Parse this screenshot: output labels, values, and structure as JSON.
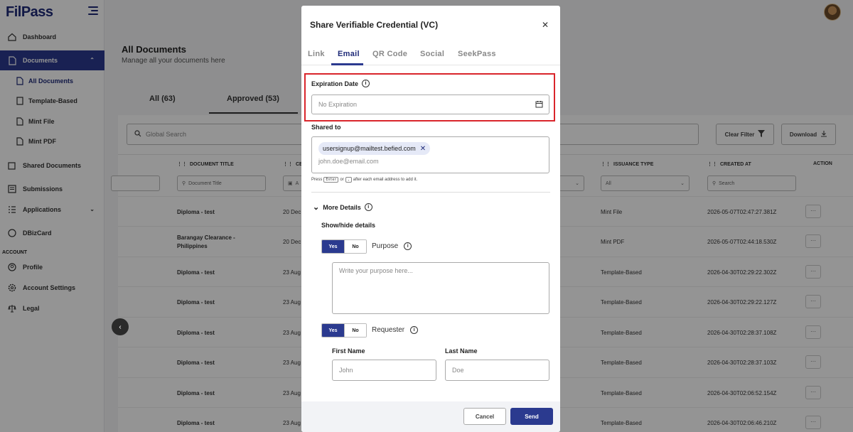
{
  "app": {
    "logo": "FilPass"
  },
  "sidebar": {
    "items": [
      {
        "label": "Dashboard",
        "icon": "dashboard-icon"
      },
      {
        "label": "Documents",
        "icon": "document-icon"
      },
      {
        "label": "All Documents",
        "icon": "all-documents-icon"
      },
      {
        "label": "Template-Based",
        "icon": "template-icon"
      },
      {
        "label": "Mint File",
        "icon": "mint-file-icon"
      },
      {
        "label": "Mint PDF",
        "icon": "mint-pdf-icon"
      },
      {
        "label": "Shared Documents",
        "icon": "shared-documents-icon"
      },
      {
        "label": "Submissions",
        "icon": "submissions-icon"
      },
      {
        "label": "Applications",
        "icon": "applications-icon"
      },
      {
        "label": "DBizCard",
        "icon": "dbizcard-icon"
      },
      {
        "label": "Profile",
        "icon": "profile-icon"
      },
      {
        "label": "Account Settings",
        "icon": "gear-icon"
      },
      {
        "label": "Legal",
        "icon": "scale-icon"
      }
    ],
    "section_account": "ACCOUNT"
  },
  "main": {
    "title": "All Documents",
    "subtitle": "Manage all your documents here",
    "tabs": [
      {
        "label": "All (63)"
      },
      {
        "label": "Approved (53)"
      }
    ],
    "search_placeholder": "Global Search",
    "clear_filter": "Clear Filter",
    "download": "Download",
    "columns": {
      "doc_title": "DOCUMENT TITLE",
      "ce": "CE",
      "issuance_type": "ISSUANCE TYPE",
      "created_at": "CREATED AT",
      "action": "ACTION"
    },
    "filters": {
      "doc_title": "Document Title",
      "ce": "A",
      "issuance": "All",
      "created": "Search"
    },
    "rows": [
      {
        "title": "Diploma - test",
        "date": "20 Dec",
        "type": "Mint File",
        "created": "2026-05-07T02:47:27.381Z"
      },
      {
        "title": "Barangay Clearance - Philippines",
        "date": "20 Dec",
        "type": "Mint PDF",
        "created": "2026-05-07T02:44:18.530Z"
      },
      {
        "title": "Diploma - test",
        "date": "23 Aug",
        "type": "Template-Based",
        "created": "2026-04-30T02:29:22.302Z"
      },
      {
        "title": "Diploma - test",
        "date": "23 Aug",
        "type": "Template-Based",
        "created": "2026-04-30T02:29:22.127Z"
      },
      {
        "title": "Diploma - test",
        "date": "23 Aug",
        "type": "Template-Based",
        "created": "2026-04-30T02:28:37.108Z"
      },
      {
        "title": "Diploma - test",
        "date": "23 Aug",
        "type": "Template-Based",
        "created": "2026-04-30T02:28:37.103Z"
      },
      {
        "title": "Diploma - test",
        "date": "23 Aug",
        "type": "Template-Based",
        "created": "2026-04-30T02:06:52.154Z"
      },
      {
        "title": "Diploma - test",
        "date": "23 Aug",
        "type": "Template-Based",
        "created": "2026-04-30T02:06:46.210Z"
      }
    ],
    "action_label": "···"
  },
  "modal": {
    "title": "Share Verifiable Credential (VC)",
    "tabs": [
      "Link",
      "Email",
      "QR Code",
      "Social",
      "SeekPass"
    ],
    "active_tab": "Email",
    "expiration_label": "Expiration Date",
    "expiration_placeholder": "No Expiration",
    "shared_to_label": "Shared to",
    "chip_email": "usersignup@mailtest.befied.com",
    "email_placeholder": "john.doe@email.com",
    "hint": {
      "pre": "Press",
      "key1": "Enter",
      "mid": "or",
      "key2": ",",
      "post": "after each email address to add it."
    },
    "more_details": "More Details",
    "show_hide": "Show/hide details",
    "yes": "Yes",
    "no": "No",
    "purpose_label": "Purpose",
    "purpose_placeholder": "Write your purpose here...",
    "requester_label": "Requester",
    "first_name_label": "First Name",
    "last_name_label": "Last Name",
    "first_name_placeholder": "John",
    "last_name_placeholder": "Doe",
    "cancel": "Cancel",
    "send": "Send"
  },
  "colors": {
    "primary": "#2b3a8f",
    "highlight": "#d9252b"
  }
}
